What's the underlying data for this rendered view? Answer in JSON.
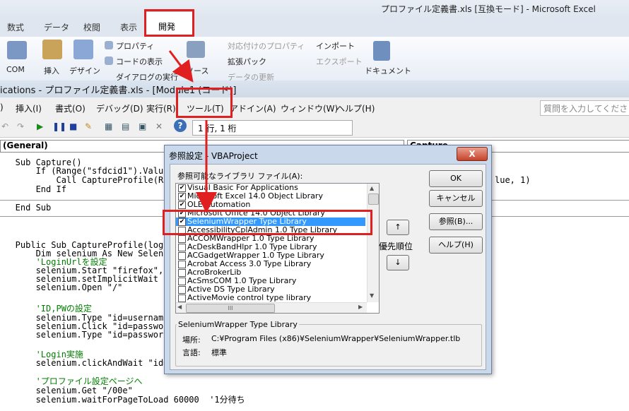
{
  "excel": {
    "title": "プロファイル定義書.xls [互換モード] - Microsoft Excel",
    "tabs": [
      "数式",
      "データ",
      "校閲",
      "表示",
      "開発"
    ],
    "ribbon": {
      "com": "COM",
      "insert": "挿入",
      "design": "デザイン",
      "property": "プロパティ",
      "view_code": "コードの表示",
      "run_dialog": "ダイアログの実行",
      "source": "ソース",
      "map_property": "対応付けのプロパティ",
      "expansion_pack": "拡張パック",
      "refresh_data": "データの更新",
      "import": "インポート",
      "export": "エクスポート",
      "document": "ドキュメント"
    }
  },
  "vbe": {
    "title": "ications - プロファイル定義書.xls - [Module1 (コード)]",
    "menu": [
      ")",
      "挿入(I)",
      "書式(O)",
      "デバッグ(D)",
      "実行(R)",
      "ツール(T)",
      "アドイン(A)",
      "ウィンドウ(W)",
      "ヘルプ(H)"
    ],
    "help_placeholder": "質問を入力してくださ",
    "cursor_position": "1 行, 1 桁",
    "object_combo": "(General)",
    "proc_combo": "Capture",
    "code_lines": [
      "   Sub Capture()",
      "       If (Range(\"sfdcid1\").Value",
      "           Call CaptureProfile(Ra",
      "       End If",
      "",
      "   End Sub",
      "",
      "",
      "",
      "   Public Sub CaptureProfile(log",
      "       Dim selenium As New Selen",
      "       'LoginUrlを設定",
      "       selenium.Start \"firefox\",",
      "       selenium.setImplicitWait 5",
      "       selenium.Open \"/\"",
      "",
      "       'ID,PWの設定",
      "       selenium.Type \"id=username",
      "       selenium.Click \"id=passwo",
      "       selenium.Type \"id=passwor",
      "",
      "       'Login実施",
      "       selenium.clickAndWait \"id=",
      "",
      "       'プロファイル設定ページへ",
      "       selenium.Get \"/00e\"",
      "       selenium.waitForPageToLoad 60000  '1分待ち"
    ],
    "code_tail_right": "lue, 1)"
  },
  "dialog": {
    "title": "参照設定 - VBAProject",
    "close": "X",
    "list_label": "参照可能なライブラリ ファイル(A):",
    "libraries": [
      {
        "name": "Visual Basic For Applications",
        "checked": true
      },
      {
        "name": "Microsoft Excel 14.0 Object Library",
        "checked": true
      },
      {
        "name": "OLE Automation",
        "checked": true
      },
      {
        "name": "Microsoft Office 14.0 Object Library",
        "checked": true
      },
      {
        "name": "SeleniumWrapper Type Library",
        "checked": true,
        "selected": true
      },
      {
        "name": "AccessibilityCplAdmin 1.0 Type Library",
        "checked": false
      },
      {
        "name": "ACCOMWrapper 1.0 Type Library",
        "checked": false
      },
      {
        "name": "AcDeskBandHlpr 1.0 Type Library",
        "checked": false
      },
      {
        "name": "ACGadgetWrapper 1.0 Type Library",
        "checked": false
      },
      {
        "name": "Acrobat Access 3.0 Type Library",
        "checked": false
      },
      {
        "name": "AcroBrokerLib",
        "checked": false
      },
      {
        "name": "AcSmsCOM 1.0 Type Library",
        "checked": false
      },
      {
        "name": "Active DS Type Library",
        "checked": false
      },
      {
        "name": "ActiveMovie control type library",
        "checked": false
      }
    ],
    "scroll_marker": "III",
    "ok": "OK",
    "cancel": "キャンセル",
    "browse": "参照(B)...",
    "help": "ヘルプ(H)",
    "priority_label": "優先順位",
    "up": "↑",
    "down": "↓",
    "details_title": "SeleniumWrapper Type Library",
    "location_label": "場所:",
    "location_value": "C:¥Program Files (x86)¥SeleniumWrapper¥SeleniumWrapper.tlb",
    "language_label": "言語:",
    "language_value": "標準"
  },
  "colors": {
    "annotation_red": "#e02020",
    "selection_blue": "#3399ff"
  }
}
